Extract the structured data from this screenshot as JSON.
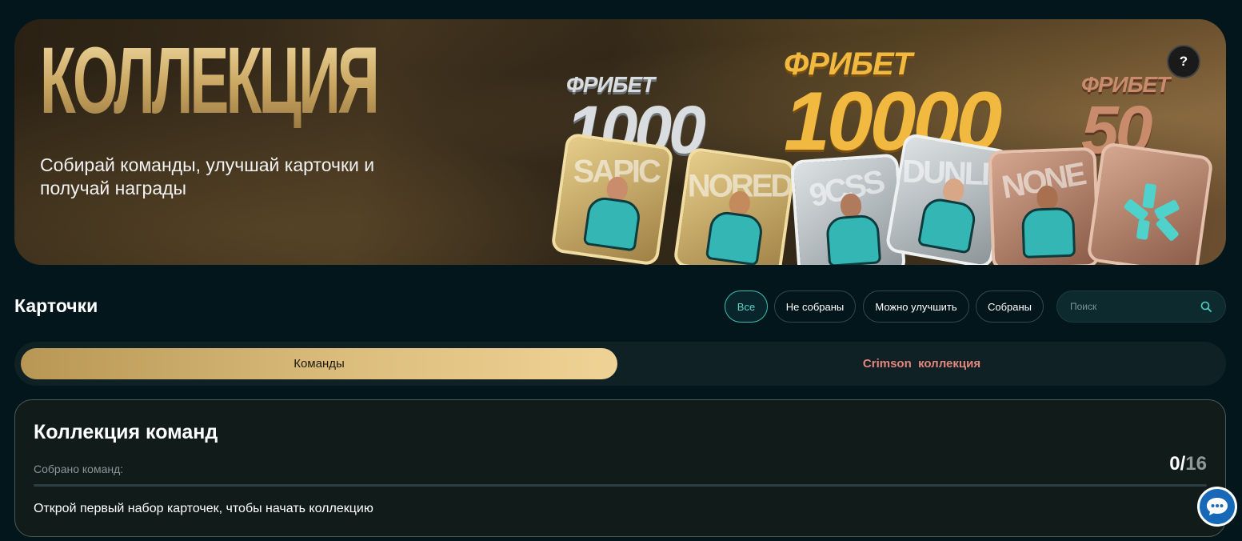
{
  "hero": {
    "title": "КОЛЛЕКЦИЯ",
    "subtitle": "Собирай команды, улучшай карточки и получай награды",
    "help_label": "?",
    "prizes": [
      {
        "label": "ФРИБЕТ",
        "amount": "1000"
      },
      {
        "label": "ФРИБЕТ",
        "amount": "10000"
      },
      {
        "label": "ФРИБЕТ",
        "amount": "50"
      }
    ],
    "cards": [
      {
        "name": "SAPIC",
        "tier": "gold"
      },
      {
        "name": "NORED",
        "tier": "gold"
      },
      {
        "name": "9CSS",
        "tier": "silver"
      },
      {
        "name": "DUNLIS",
        "tier": "silver"
      },
      {
        "name": "NONE",
        "tier": "bronze"
      },
      {
        "name": "",
        "tier": "bronze",
        "icon": "team-logo-icon"
      }
    ]
  },
  "cards_section": {
    "title": "Карточки",
    "filters": [
      "Все",
      "Не собраны",
      "Можно улучшить",
      "Собраны"
    ],
    "active_filter": "Все",
    "search_placeholder": "Поиск"
  },
  "tabs": {
    "items": [
      "Команды",
      "Crimson  коллекция"
    ],
    "active": "Команды"
  },
  "collection": {
    "title": "Коллекция команд",
    "collected_label": "Собрано команд:",
    "collected": "0",
    "separator": "/",
    "total": "16",
    "progress": 0,
    "hint": "Открой первый набор карточек, чтобы начать коллекцию"
  },
  "colors": {
    "background": "#03161c",
    "accent": "#3cbfb2",
    "gold": "#dcbd7c",
    "crimson": "#e2867e"
  },
  "icons": {
    "search": "search-icon",
    "help": "question-icon",
    "chat": "chat-icon"
  }
}
